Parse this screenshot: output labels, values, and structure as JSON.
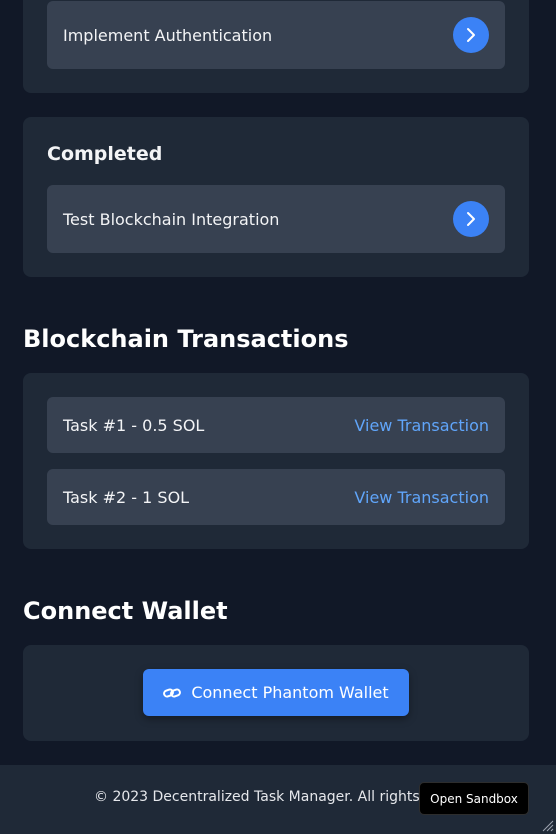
{
  "boards": {
    "in_progress": {
      "tasks": [
        {
          "title": "Implement Authentication"
        }
      ]
    },
    "completed": {
      "heading": "Completed",
      "tasks": [
        {
          "title": "Test Blockchain Integration"
        }
      ]
    },
    "task_action_icon": "chevron-right-icon"
  },
  "transactions": {
    "title": "Blockchain Transactions",
    "items": [
      {
        "label": "Task #1 - 0.5 SOL",
        "link": "View Transaction"
      },
      {
        "label": "Task #2 - 1 SOL",
        "link": "View Transaction"
      }
    ]
  },
  "wallet": {
    "title": "Connect Wallet",
    "button_label": "Connect Phantom Wallet",
    "button_icon": "link-icon"
  },
  "footer": {
    "text": "© 2023 Decentralized Task Manager. All rights reserved."
  },
  "sandbox": {
    "label": "Open Sandbox"
  },
  "colors": {
    "background": "#111827",
    "card": "#1f2937",
    "row": "#374151",
    "accent": "#3b82f6",
    "link": "#60a5fa"
  }
}
